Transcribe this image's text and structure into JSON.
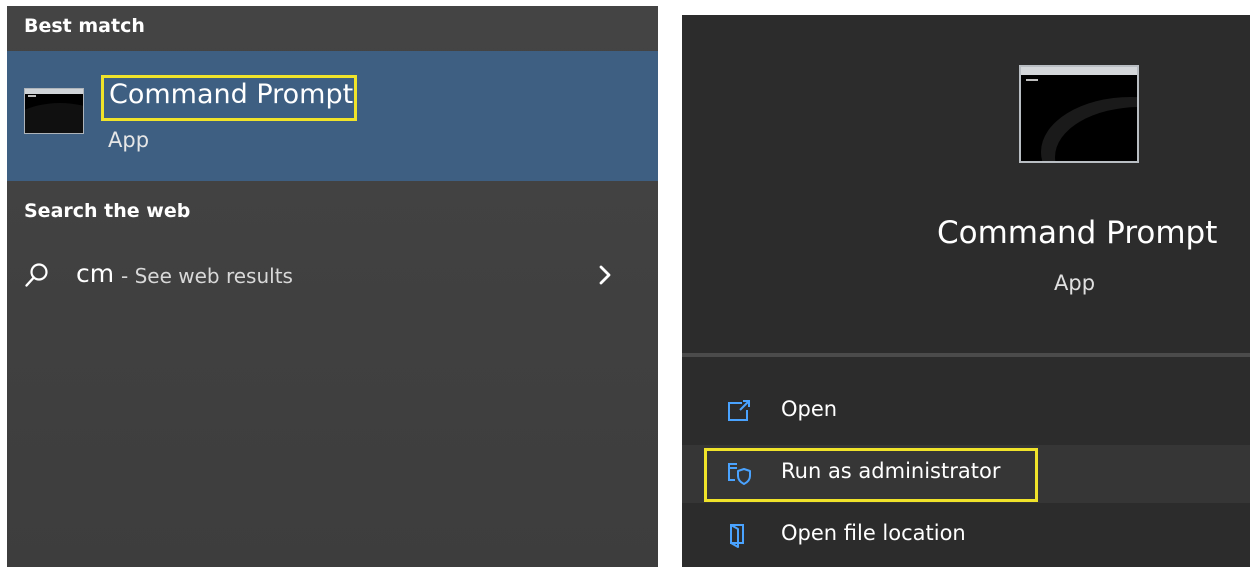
{
  "left_pane": {
    "best_match_header": "Best match",
    "best_match": {
      "title": "Command Prompt",
      "subtitle": "App",
      "icon": "command-prompt-icon"
    },
    "web_header": "Search the web",
    "web_result": {
      "query": "cm",
      "suffix": " - See web results",
      "icon": "search-icon",
      "arrow_icon": "chevron-right-icon"
    }
  },
  "right_pane": {
    "title": "Command Prompt",
    "subtitle": "App",
    "icon": "command-prompt-icon",
    "actions": [
      {
        "label": "Open",
        "icon": "open-icon"
      },
      {
        "label": "Run as administrator",
        "icon": "shield-icon"
      },
      {
        "label": "Open file location",
        "icon": "folder-location-icon"
      }
    ]
  },
  "colors": {
    "selection": "#3e5f82",
    "highlight_box": "#f0e32a",
    "left_bg": "#3f3f3f",
    "right_bg": "#2c2c2c"
  }
}
